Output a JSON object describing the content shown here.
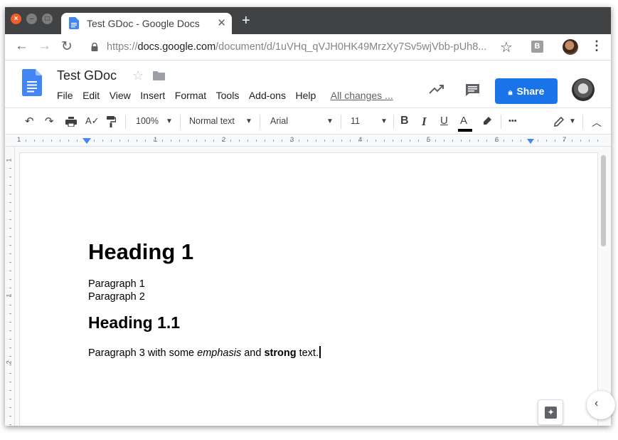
{
  "browser": {
    "tab_title": "Test GDoc - Google Docs",
    "tab_close": "✕",
    "new_tab": "+",
    "url_prefix": "https://",
    "url_domain": "docs.google.com",
    "url_path": "/document/d/1uVHq_qVJH0HK49MrzXy7Sv5wjVbb-pUh8...",
    "extension_label": "B"
  },
  "docs": {
    "title": "Test GDoc",
    "menu": [
      "File",
      "Edit",
      "View",
      "Insert",
      "Format",
      "Tools",
      "Add-ons",
      "Help"
    ],
    "changes_status": "All changes ...",
    "share_label": "Share"
  },
  "toolbar": {
    "zoom": "100%",
    "style": "Normal text",
    "font": "Arial",
    "font_size": "11",
    "bold": "B",
    "italic": "I",
    "underline": "U",
    "text_color": "A",
    "more": "•••"
  },
  "ruler": {
    "numbers": [
      "1",
      "1",
      "2",
      "3",
      "4",
      "5",
      "6",
      "7"
    ]
  },
  "vruler": {
    "numbers": [
      "1",
      "1",
      "2"
    ]
  },
  "document": {
    "heading1": "Heading 1",
    "paragraph1": "Paragraph 1",
    "paragraph2": "Paragraph 2",
    "heading1_1": "Heading 1.1",
    "p3_part1": "Paragraph 3 with some ",
    "p3_em": "emphasis",
    "p3_part2": " and ",
    "p3_strong": "strong",
    "p3_part3": " text."
  },
  "colors": {
    "share_blue": "#1a73e8",
    "docs_blue": "#4285f4",
    "tab_strip": "#404244"
  }
}
